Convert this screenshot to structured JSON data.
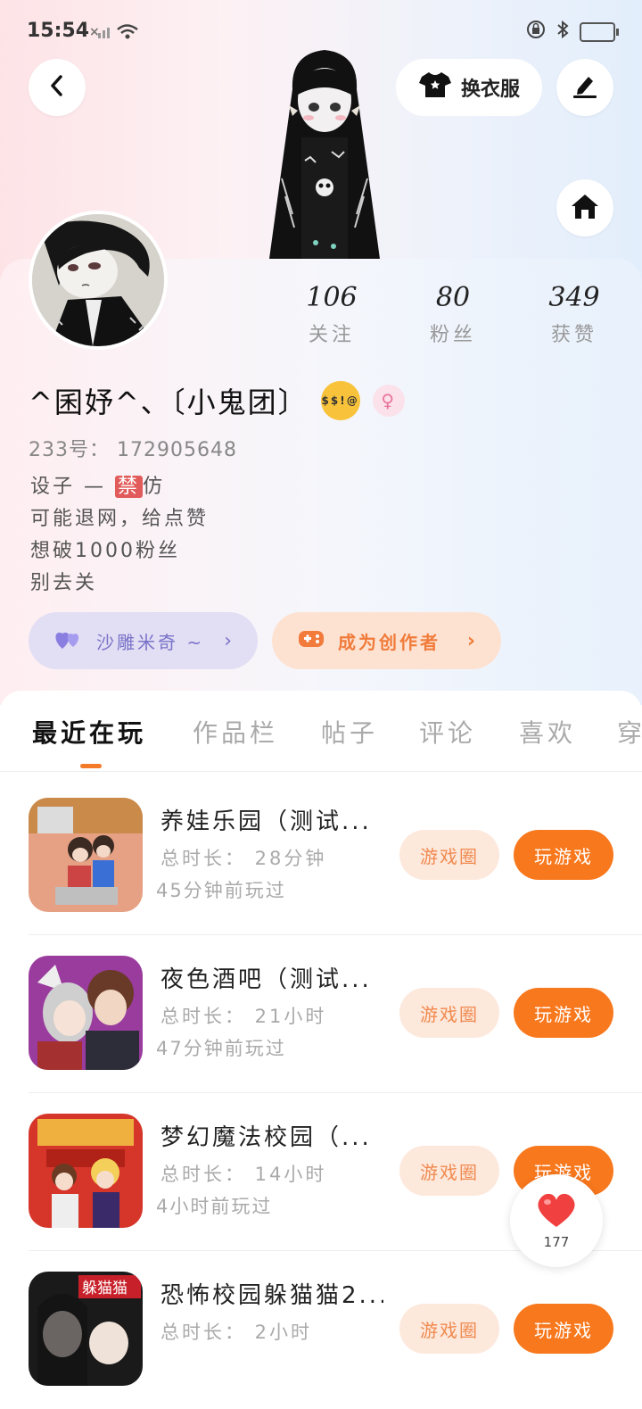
{
  "status_bar": {
    "time": "15:54",
    "signal": "×ıl"
  },
  "header": {
    "change_outfit_label": "换衣服"
  },
  "profile": {
    "stats": [
      {
        "value": "106",
        "label": "关注"
      },
      {
        "value": "80",
        "label": "粉丝"
      },
      {
        "value": "349",
        "label": "获赞"
      }
    ],
    "name": "^囷妤^、〔小鬼团〕",
    "uid": "233号： 172905648",
    "bio_line1_a": "设子 — ",
    "bio_line1_ban": "禁",
    "bio_line1_b": "仿",
    "bio_line2": "可能退网，给点赞",
    "bio_line3": "想破1000粉丝",
    "bio_line4": "别去关",
    "badge_group": "沙雕米奇 ~",
    "badge_creator": "成为创作者",
    "face_emoji_text": "$$!@"
  },
  "tabs": [
    "最近在玩",
    "作品栏",
    "帖子",
    "评论",
    "喜欢",
    "穿"
  ],
  "games": [
    {
      "title": "养娃乐园（测试...",
      "duration": "总时长： 28分钟",
      "last_played": "45分钟前玩过",
      "circle_btn": "游戏圈",
      "play_btn": "玩游戏"
    },
    {
      "title": "夜色酒吧（测试...",
      "duration": "总时长： 21小时",
      "last_played": "47分钟前玩过",
      "circle_btn": "游戏圈",
      "play_btn": "玩游戏"
    },
    {
      "title": "梦幻魔法校园（...",
      "duration": "总时长： 14小时",
      "last_played": "4小时前玩过",
      "circle_btn": "游戏圈",
      "play_btn": "玩游戏"
    },
    {
      "title": "恐怖校园躲猫猫2...",
      "duration": "总时长： 2小时",
      "last_played": "",
      "circle_btn": "游戏圈",
      "play_btn": "玩游戏",
      "thumb_text": "躲猫猫"
    }
  ],
  "like_button": {
    "count": "177"
  },
  "colors": {
    "accent": "#f8781d",
    "accent_light": "#fde8dc",
    "badge_purple": "#e2def4"
  }
}
